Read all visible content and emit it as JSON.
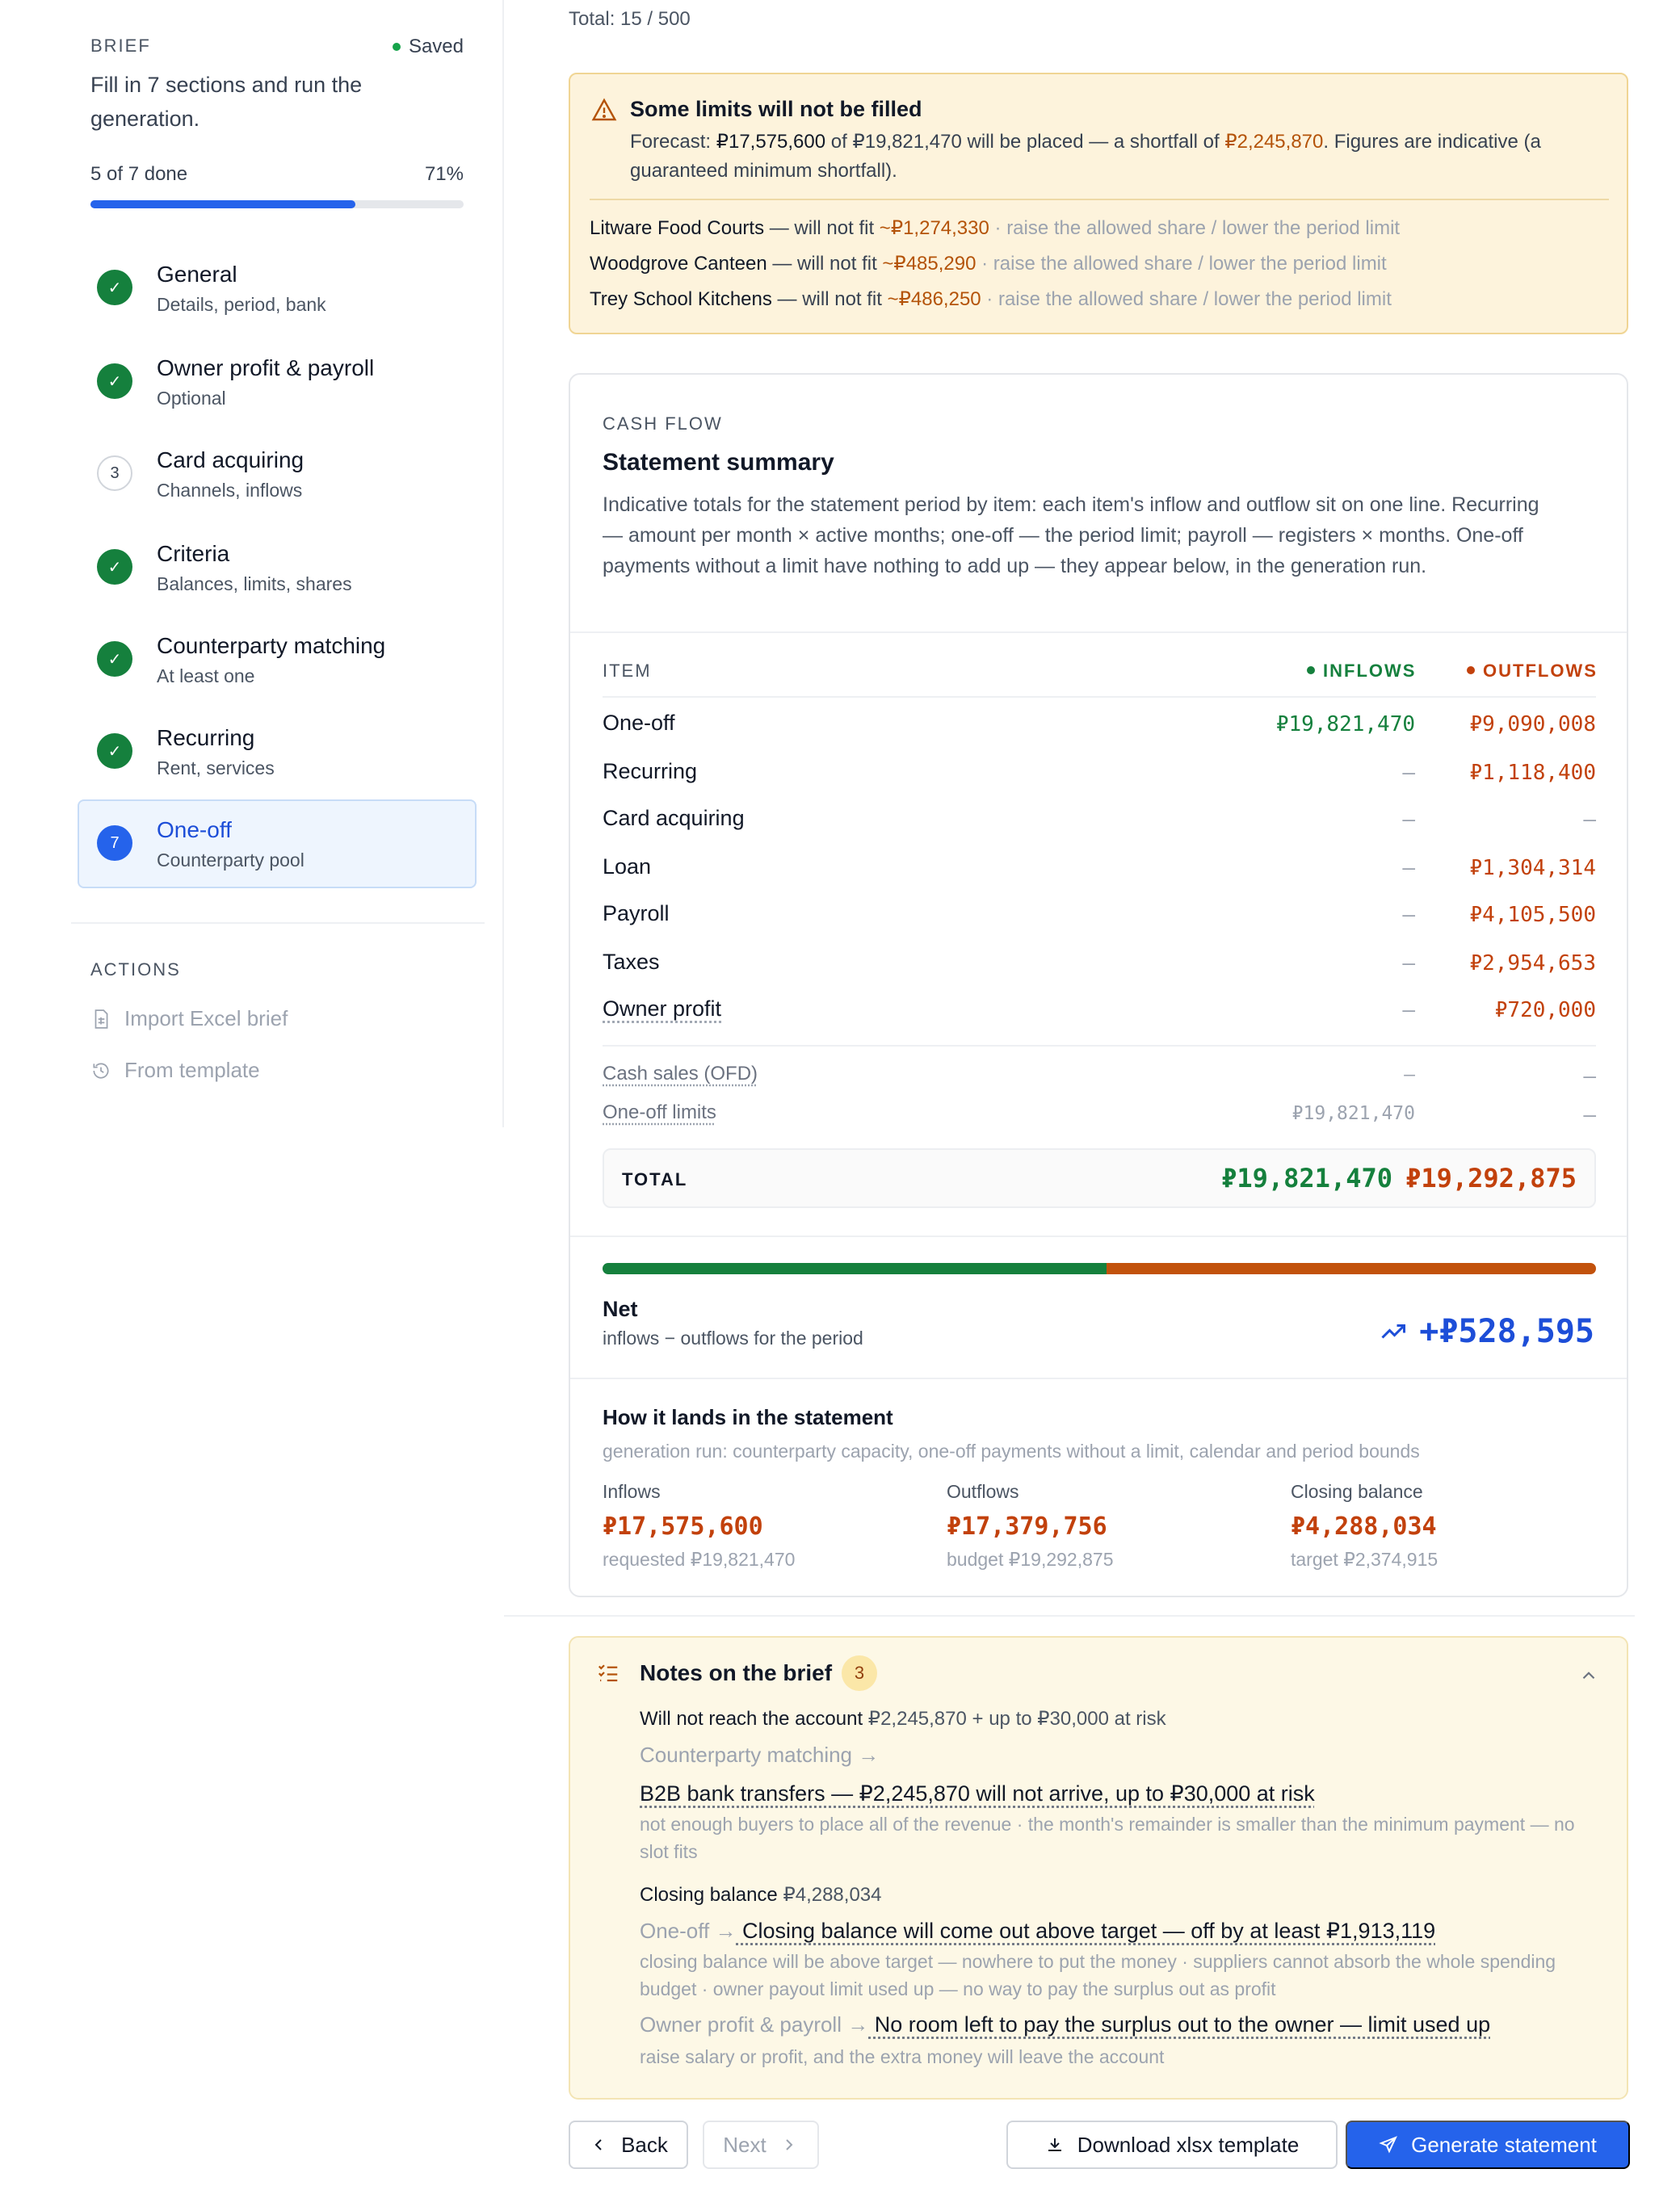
{
  "sidebar": {
    "section_label": "BRIEF",
    "saved_label": "Saved",
    "description": "Fill in 7 sections and run the generation.",
    "progress_text": "5 of 7 done",
    "progress_percent": "71%",
    "progress_fraction": 0.71,
    "steps": [
      {
        "marker": "✓",
        "title": "General",
        "subtitle": "Details, period, bank",
        "state": "done"
      },
      {
        "marker": "✓",
        "title": "Owner profit & payroll",
        "subtitle": "Optional",
        "state": "done"
      },
      {
        "marker": "3",
        "title": "Card acquiring",
        "subtitle": "Channels, inflows",
        "state": "todo"
      },
      {
        "marker": "✓",
        "title": "Criteria",
        "subtitle": "Balances, limits, shares",
        "state": "done"
      },
      {
        "marker": "✓",
        "title": "Counterparty matching",
        "subtitle": "At least one",
        "state": "done"
      },
      {
        "marker": "✓",
        "title": "Recurring",
        "subtitle": "Rent, services",
        "state": "done"
      },
      {
        "marker": "7",
        "title": "One-off",
        "subtitle": "Counterparty pool",
        "state": "active"
      }
    ],
    "actions_label": "ACTIONS",
    "actions": [
      {
        "label": "Import Excel brief",
        "icon": "file-spreadsheet-icon"
      },
      {
        "label": "From template",
        "icon": "history-icon"
      }
    ]
  },
  "main": {
    "total_line": "Total: 15 / 500",
    "warning": {
      "title": "Some limits will not be filled",
      "text_prefix": "Forecast: ",
      "forecast_placed": "₽17,575,600",
      "text_mid": " of ₽19,821,470 will be placed — a shortfall of ",
      "shortfall": "₽2,245,870",
      "text_suffix": ". Figures are indicative (a guaranteed minimum shortfall).",
      "rows": [
        {
          "name": "Litware Food Courts",
          "text": " — will not fit ",
          "amount": "~₽1,274,330",
          "hint": " · raise the allowed share / lower the period limit"
        },
        {
          "name": "Woodgrove Canteen",
          "text": " — will not fit ",
          "amount": "~₽485,290",
          "hint": " · raise the allowed share / lower the period limit"
        },
        {
          "name": "Trey School Kitchens",
          "text": " — will not fit ",
          "amount": "~₽486,250",
          "hint": " · raise the allowed share / lower the period limit"
        }
      ]
    },
    "cashflow": {
      "label": "CASH FLOW",
      "title": "Statement summary",
      "description": "Indicative totals for the statement period by item: each item's inflow and outflow sit on one line. Recurring — amount per month × active months; one-off — the period limit; payroll — registers × months. One-off payments without a limit have nothing to add up — they appear below, in the generation run.",
      "col_item": "ITEM",
      "col_in": "INFLOWS",
      "col_out": "OUTFLOWS",
      "rows": [
        {
          "item": "One-off",
          "in": "₽19,821,470",
          "out": "₽9,090,008"
        },
        {
          "item": "Recurring",
          "in": "—",
          "out": "₽1,118,400"
        },
        {
          "item": "Card acquiring",
          "in": "—",
          "out": "—"
        },
        {
          "item": "Loan",
          "in": "—",
          "out": "₽1,304,314"
        },
        {
          "item": "Payroll",
          "in": "—",
          "out": "₽4,105,500"
        },
        {
          "item": "Taxes",
          "in": "—",
          "out": "₽2,954,653"
        },
        {
          "item": "Owner profit",
          "in": "—",
          "out": "₽720,000"
        }
      ],
      "sub_rows": [
        {
          "item": "Cash sales (OFD)",
          "in": "—",
          "out": "—"
        },
        {
          "item": "One-off limits",
          "in": "₽19,821,470",
          "out": "—"
        }
      ],
      "total_label": "TOTAL",
      "total_in": "₽19,821,470",
      "total_out": "₽19,292,875",
      "inflow_share": 0.507,
      "net_title": "Net",
      "net_sub": "inflows − outflows for the period",
      "net_value": "+₽528,595",
      "lands_title": "How it lands in the statement",
      "lands_sub": "generation run: counterparty capacity, one-off payments without a limit, calendar and period bounds",
      "lands": [
        {
          "head": "Inflows",
          "value": "₽17,575,600",
          "sub": "requested ₽19,821,470"
        },
        {
          "head": "Outflows",
          "value": "₽17,379,756",
          "sub": "budget ₽19,292,875"
        },
        {
          "head": "Closing balance",
          "value": "₽4,288,034",
          "sub": "target ₽2,374,915"
        }
      ]
    },
    "notes": {
      "title": "Notes on the brief",
      "count": "3",
      "n1_head": "Will not reach the account",
      "n1_head_val": " ₽2,245,870 + up to ₽30,000 at risk",
      "n1_link": "Counterparty matching →",
      "n1_main": "B2B bank transfers — ₽2,245,870 will not arrive, up to ₽30,000 at risk",
      "n1_small": "not enough buyers to place all of the revenue · the month's remainder is smaller than the minimum payment — no slot fits",
      "n2_head": "Closing balance",
      "n2_head_val": " ₽4,288,034",
      "n2_link": "One-off →",
      "n2_main": " Closing balance will come out above target — off by at least ₽1,913,119",
      "n2_small": "closing balance will be above target — nowhere to put the money · suppliers cannot absorb the whole spending budget · owner payout limit used up — no way to pay the surplus out as profit",
      "n3_link": "Owner profit & payroll →",
      "n3_main": " No room left to pay the surplus out to the owner — limit used up",
      "n3_small": "raise salary or profit, and the extra money will leave the account"
    }
  },
  "footer": {
    "back": "Back",
    "next": "Next",
    "download": "Download xlsx template",
    "generate": "Generate statement"
  },
  "colors": {
    "accent": "#2563eb",
    "inflow": "#15803d",
    "outflow": "#c2410c",
    "warning_bg": "#fdf3dc"
  }
}
